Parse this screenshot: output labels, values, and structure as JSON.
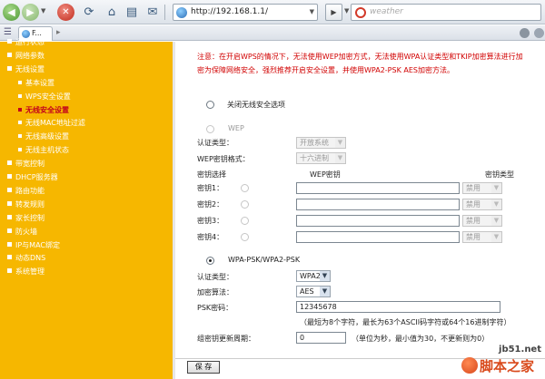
{
  "browser": {
    "url": "http://192.168.1.1/",
    "search_placeholder": "weather",
    "tab_label": "F..."
  },
  "sidebar": {
    "items": [
      {
        "label": "运行状态",
        "sub": false
      },
      {
        "label": "网络参数",
        "sub": false
      },
      {
        "label": "无线设置",
        "sub": false
      },
      {
        "label": "基本设置",
        "sub": true
      },
      {
        "label": "WPS安全设置",
        "sub": true
      },
      {
        "label": "无线安全设置",
        "sub": true,
        "active": true
      },
      {
        "label": "无线MAC地址过滤",
        "sub": true
      },
      {
        "label": "无线高级设置",
        "sub": true
      },
      {
        "label": "无线主机状态",
        "sub": true
      },
      {
        "label": "带宽控制",
        "sub": false
      },
      {
        "label": "DHCP服务器",
        "sub": false
      },
      {
        "label": "路由功能",
        "sub": false
      },
      {
        "label": "转发规则",
        "sub": false
      },
      {
        "label": "家长控制",
        "sub": false
      },
      {
        "label": "防火墙",
        "sub": false
      },
      {
        "label": "IP与MAC绑定",
        "sub": false
      },
      {
        "label": "动态DNS",
        "sub": false
      },
      {
        "label": "系统管理",
        "sub": false
      }
    ],
    "active_color": "#c2001b",
    "bg_color": "#f6b700"
  },
  "main": {
    "notice": "注意：在开启WPS的情况下，无法使用WEP加密方式，无法使用WPA认证类型和TKIP加密算法进行加密为保障网络安全，强烈推荐开启安全设置，并使用WPA2-PSK AES加密方法。",
    "option_off": "关闭无线安全选项",
    "wep": {
      "title": "WEP",
      "auth_label": "认证类型：",
      "auth_value": "开放系统",
      "format_label": "WEP密钥格式：",
      "format_value": "十六进制",
      "col_select": "密钥选择",
      "col_key": "WEP密钥",
      "col_type": "密钥类型",
      "keys": [
        {
          "label": "密钥1：",
          "type": "禁用"
        },
        {
          "label": "密钥2：",
          "type": "禁用"
        },
        {
          "label": "密钥3：",
          "type": "禁用"
        },
        {
          "label": "密钥4：",
          "type": "禁用"
        }
      ]
    },
    "wpa": {
      "title": "WPA-PSK/WPA2-PSK",
      "auth_label": "认证类型：",
      "auth_value": "WPA2",
      "alg_label": "加密算法：",
      "alg_value": "AES",
      "psk_label": "PSK密码：",
      "psk_value": "12345678",
      "psk_hint": "（最短为8个字符，最长为63个ASCII码字符或64个16进制字符）",
      "renew_label": "组密钥更新周期：",
      "renew_value": "0",
      "renew_hint": "（单位为秒，最小值为30，不更新则为0）"
    },
    "save_label": "保 存"
  },
  "watermark": {
    "url": "jb51.net",
    "text": "脚本之家"
  }
}
